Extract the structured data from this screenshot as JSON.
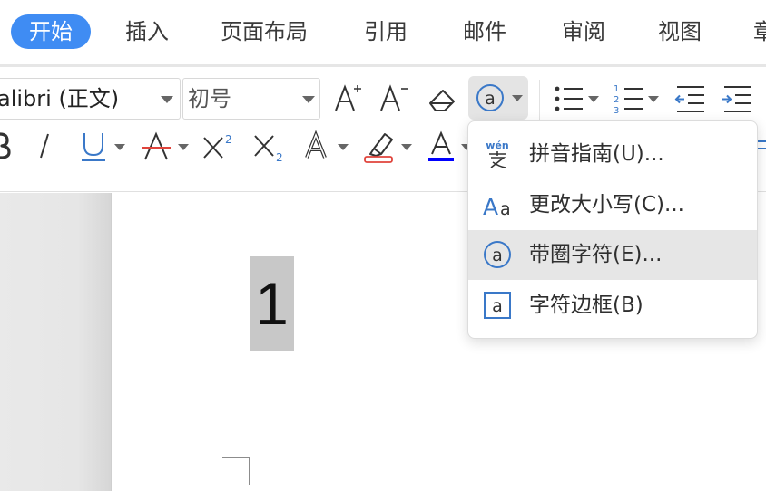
{
  "tabs": [
    {
      "label": "开始",
      "active": true
    },
    {
      "label": "插入"
    },
    {
      "label": "页面布局"
    },
    {
      "label": "引用"
    },
    {
      "label": "邮件"
    },
    {
      "label": "审阅"
    },
    {
      "label": "视图"
    },
    {
      "label": "章"
    }
  ],
  "ribbon": {
    "font_name": "alibri (正文)",
    "font_size": "初号"
  },
  "icons": {
    "grow_font": "increase-font-size-icon",
    "shrink_font": "decrease-font-size-icon",
    "clear_format": "eraser-icon",
    "enclosed_char": "enclosed-character-icon",
    "bullets": "bulleted-list-icon",
    "numbering": "numbered-list-icon",
    "outdent": "decrease-indent-icon",
    "indent": "increase-indent-icon",
    "bold": "bold-icon",
    "italic": "italic-icon",
    "underline": "underline-icon",
    "strike": "strikethrough-icon",
    "superscript": "superscript-icon",
    "subscript": "subscript-icon",
    "text_effect": "text-effect-icon",
    "highlight": "highlighter-icon",
    "font_color": "font-color-icon"
  },
  "colors": {
    "accent": "#3f8cf3",
    "font_color_bar": "#0000ff",
    "strike_line": "#e0443c",
    "icon_blue": "#3a78c8",
    "menu_highlight": "#e6e6e6"
  },
  "document": {
    "selected_text": "1"
  },
  "menu": {
    "items": [
      {
        "label": "拼音指南(U)...",
        "icon": "phonetic-guide-icon"
      },
      {
        "label": "更改大小写(C)...",
        "icon": "change-case-icon"
      },
      {
        "label": "带圈字符(E)...",
        "icon": "enclosed-character-icon",
        "highlighted": true
      },
      {
        "label": "字符边框(B)",
        "icon": "character-border-icon"
      }
    ],
    "phonetic_sample": "wén",
    "case_sample_upper": "A",
    "case_sample_lower": "a",
    "circled_sample": "a",
    "border_sample": "a"
  }
}
